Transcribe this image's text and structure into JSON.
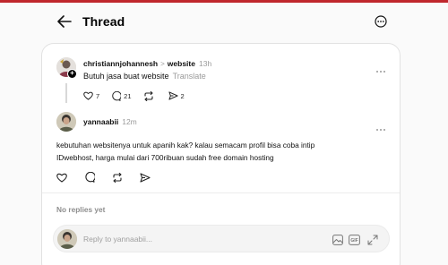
{
  "colors": {
    "top_accent": "#c0272d",
    "text": "#111111",
    "muted": "#9a9a9a",
    "card_bg": "#ffffff",
    "page_bg": "#fafafa"
  },
  "header": {
    "title": "Thread",
    "back_icon": "arrow-left-icon",
    "menu_icon": "more-circle-icon"
  },
  "op": {
    "username": "christiannjohannesh",
    "separator": ">",
    "topic": "website",
    "time": "13h",
    "text": "Butuh jasa buat website",
    "translate": "Translate",
    "likes": "7",
    "comments": "21",
    "shares": "2"
  },
  "reply": {
    "username": "yannaabii",
    "time": "12m",
    "text": "kebutuhan websitenya untuk apanih kak? kalau semacam profil bisa coba intip IDwebhost, harga mulai dari 700ribuan sudah free domain hosting"
  },
  "no_replies": "No replies yet",
  "composer": {
    "placeholder": "Reply to yannaabii...",
    "gif_label": "GIF"
  }
}
